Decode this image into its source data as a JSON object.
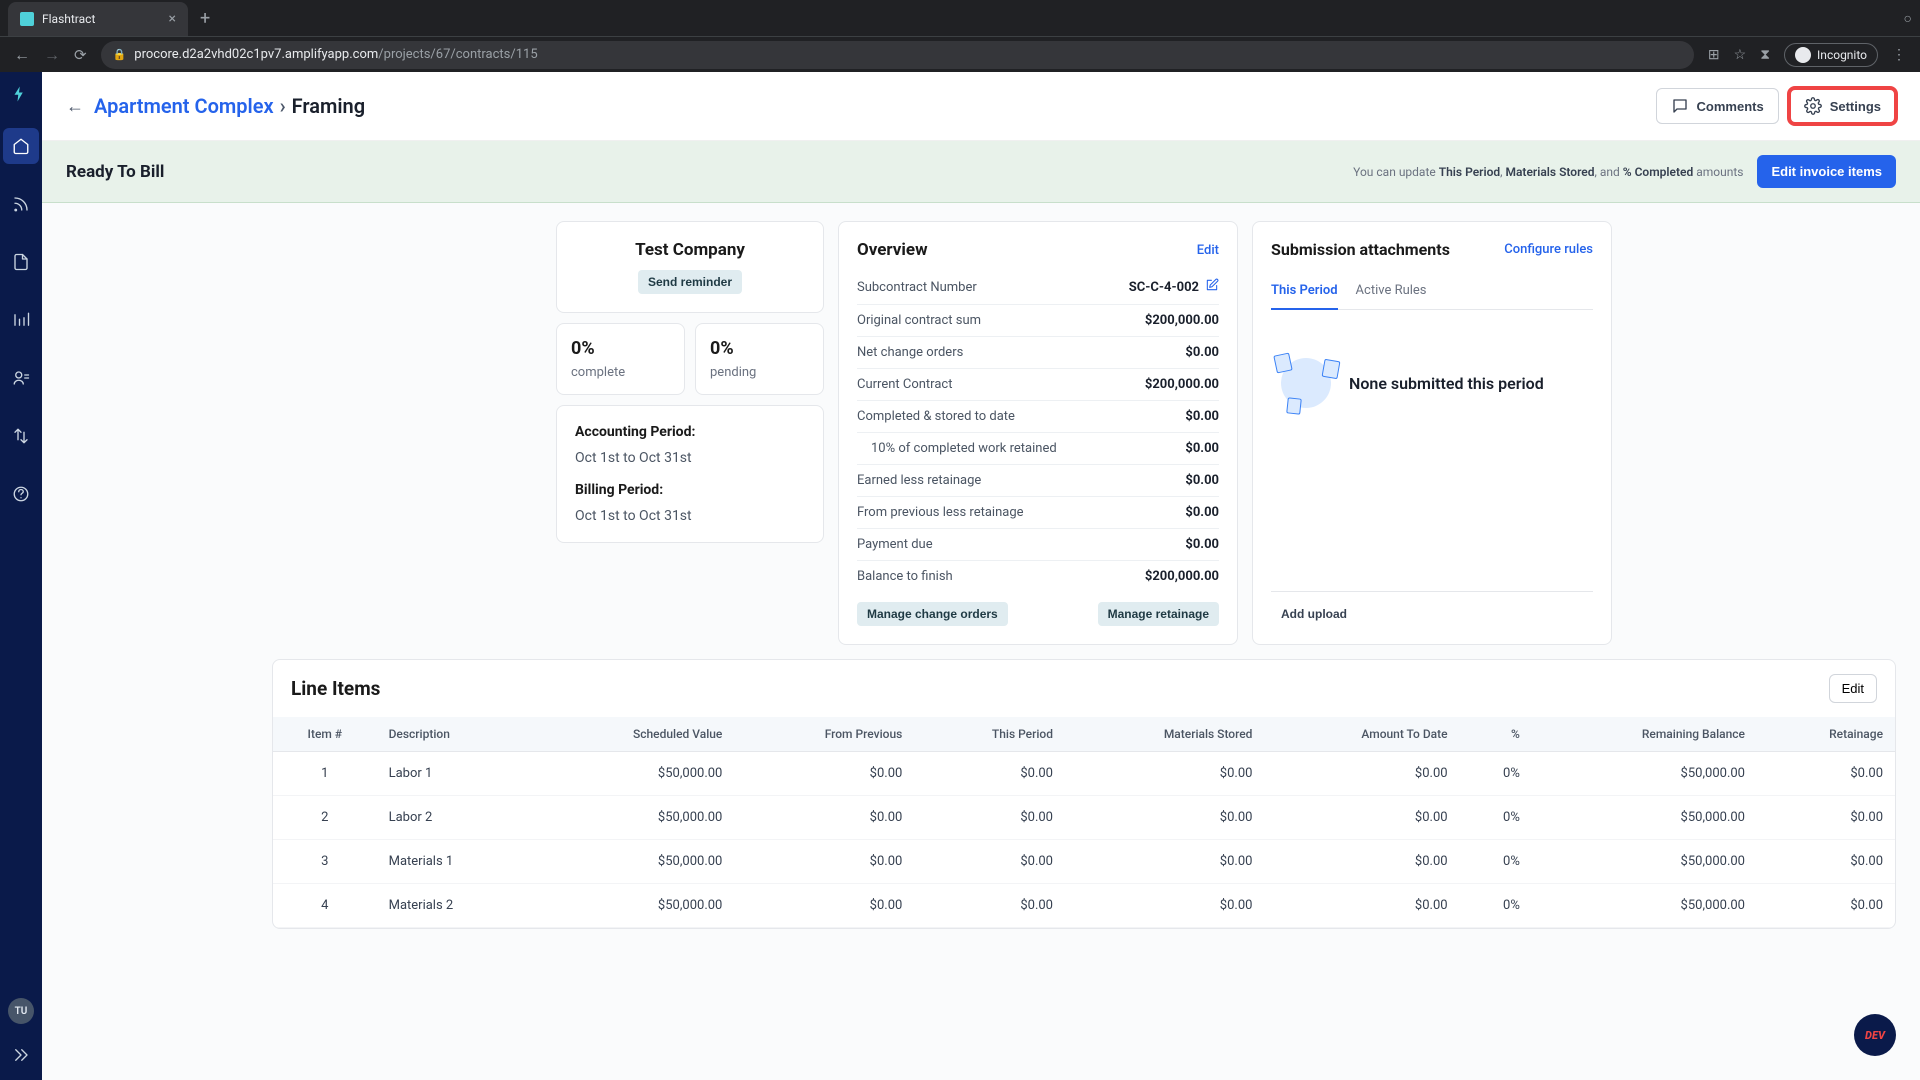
{
  "browser": {
    "tab_title": "Flashtract",
    "url_host": "procore.d2a2vhd02c1pv7.amplifyapp.com",
    "url_path": "/projects/67/contracts/115",
    "incognito": "Incognito"
  },
  "header": {
    "breadcrumb_back": "←",
    "breadcrumb_link": "Apartment Complex",
    "breadcrumb_current": "Framing",
    "comments": "Comments",
    "settings": "Settings"
  },
  "status": {
    "title": "Ready To Bill",
    "note_prefix": "You can update ",
    "note_b1": "This Period",
    "note_sep1": ", ",
    "note_b2": "Materials Stored",
    "note_sep2": ", and ",
    "note_b3": "% Completed",
    "note_suffix": " amounts",
    "edit": "Edit invoice items"
  },
  "company": {
    "name": "Test Company",
    "send_reminder": "Send reminder",
    "pct_complete_val": "0%",
    "pct_complete_label": "complete",
    "pct_pending_val": "0%",
    "pct_pending_label": "pending",
    "accounting_label": "Accounting Period:",
    "accounting_val": "Oct 1st to Oct 31st",
    "billing_label": "Billing Period:",
    "billing_val": "Oct 1st to Oct 31st"
  },
  "overview": {
    "title": "Overview",
    "edit": "Edit",
    "rows": [
      {
        "label": "Subcontract Number",
        "value": "SC-C-4-002",
        "editable": true
      },
      {
        "label": "Original contract sum",
        "value": "$200,000.00"
      },
      {
        "label": "Net change orders",
        "value": "$0.00"
      },
      {
        "label": "Current Contract",
        "value": "$200,000.00"
      },
      {
        "label": "Completed & stored to date",
        "value": "$0.00"
      },
      {
        "label": "10% of completed work retained",
        "value": "$0.00",
        "indent": true
      },
      {
        "label": "Earned less retainage",
        "value": "$0.00"
      },
      {
        "label": "From previous less retainage",
        "value": "$0.00"
      },
      {
        "label": "Payment due",
        "value": "$0.00"
      },
      {
        "label": "Balance to finish",
        "value": "$200,000.00"
      }
    ],
    "manage_change": "Manage change orders",
    "manage_retainage": "Manage retainage"
  },
  "submissions": {
    "title": "Submission attachments",
    "configure": "Configure rules",
    "tab_active": "This Period",
    "tab_other": "Active Rules",
    "empty": "None submitted this period",
    "add": "Add upload"
  },
  "line_items": {
    "title": "Line Items",
    "edit": "Edit",
    "columns": [
      "Item #",
      "Description",
      "Scheduled Value",
      "From Previous",
      "This Period",
      "Materials Stored",
      "Amount To Date",
      "%",
      "Remaining Balance",
      "Retainage"
    ],
    "rows": [
      {
        "n": "1",
        "desc": "Labor 1",
        "sched": "$50,000.00",
        "prev": "$0.00",
        "period": "$0.00",
        "stored": "$0.00",
        "todate": "$0.00",
        "pct": "0%",
        "remain": "$50,000.00",
        "ret": "$0.00"
      },
      {
        "n": "2",
        "desc": "Labor 2",
        "sched": "$50,000.00",
        "prev": "$0.00",
        "period": "$0.00",
        "stored": "$0.00",
        "todate": "$0.00",
        "pct": "0%",
        "remain": "$50,000.00",
        "ret": "$0.00"
      },
      {
        "n": "3",
        "desc": "Materials 1",
        "sched": "$50,000.00",
        "prev": "$0.00",
        "period": "$0.00",
        "stored": "$0.00",
        "todate": "$0.00",
        "pct": "0%",
        "remain": "$50,000.00",
        "ret": "$0.00"
      },
      {
        "n": "4",
        "desc": "Materials 2",
        "sched": "$50,000.00",
        "prev": "$0.00",
        "period": "$0.00",
        "stored": "$0.00",
        "todate": "$0.00",
        "pct": "0%",
        "remain": "$50,000.00",
        "ret": "$0.00"
      }
    ]
  },
  "sidebar_avatar": "TU",
  "dev": "DEV"
}
